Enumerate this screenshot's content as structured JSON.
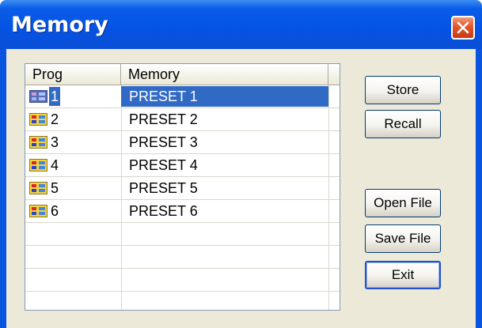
{
  "window": {
    "title": "Memory"
  },
  "list": {
    "columns": [
      "Prog",
      "Memory"
    ],
    "rows": [
      {
        "prog": "1",
        "memory": "PRESET 1",
        "selected": true
      },
      {
        "prog": "2",
        "memory": "PRESET 2"
      },
      {
        "prog": "3",
        "memory": "PRESET 3"
      },
      {
        "prog": "4",
        "memory": "PRESET 4"
      },
      {
        "prog": "5",
        "memory": "PRESET 5"
      },
      {
        "prog": "6",
        "memory": "PRESET 6"
      }
    ]
  },
  "buttons": {
    "store": "Store",
    "recall": "Recall",
    "open_file": "Open File",
    "save_file": "Save File",
    "exit": "Exit"
  },
  "icons": {
    "row_icon": "preset-icon",
    "close": "close-icon"
  },
  "colors": {
    "titlebar": "#0553e3",
    "selection": "#316ac5",
    "close_button": "#e3542a",
    "dialog_bg": "#ece9d8"
  }
}
